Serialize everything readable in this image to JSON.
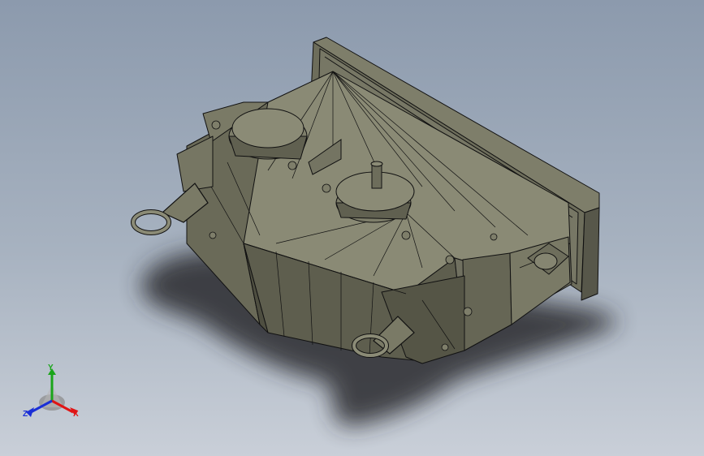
{
  "colors": {
    "background_top": "#8c9aad",
    "background_mid": "#a7b2c0",
    "background_bottom": "#c9cfd8",
    "model_face_light": "#868671",
    "model_face_mid": "#6c6c5a",
    "model_face_dark": "#4e4e40",
    "edge_line": "#111111",
    "shadow": "#2a2b2e",
    "axis_x": "#e01414",
    "axis_y": "#1aa51a",
    "axis_z": "#1a2fd6"
  },
  "model": {
    "icon": "gearbox-housing-model"
  },
  "triad": {
    "icon": "coordinate-triad-icon",
    "x_label": "X",
    "y_label": "Y",
    "z_label": "Z"
  }
}
